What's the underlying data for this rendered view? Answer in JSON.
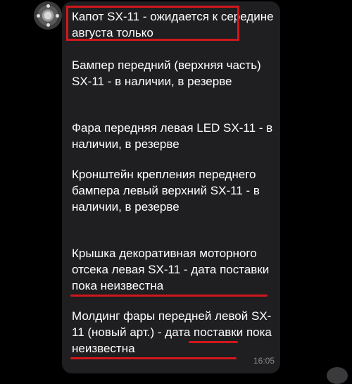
{
  "chat": {
    "messages": [
      {
        "text": "Капот SX-11 - ожидается к середине августа только"
      },
      {
        "text": "Бампер передний (верхняя часть) SX-11 - в наличии, в резерве"
      },
      {
        "text": "Фара передняя левая LED SX-11 - в наличии, в резерве"
      },
      {
        "text": "Кронштейн крепления переднего бампера левый верхний SX-11 - в наличии, в резерве"
      },
      {
        "text": "Крышка декоративная моторного отсека левая SX-11 - дата поставки пока неизвестна"
      },
      {
        "text": "Молдинг фары передней левой SX-11 (новый арт.) - дата поставки пока неизвестна"
      }
    ],
    "timestamp": "16:05",
    "highlight_color": "#d0171c",
    "bubble_color": "#1f1f21"
  }
}
